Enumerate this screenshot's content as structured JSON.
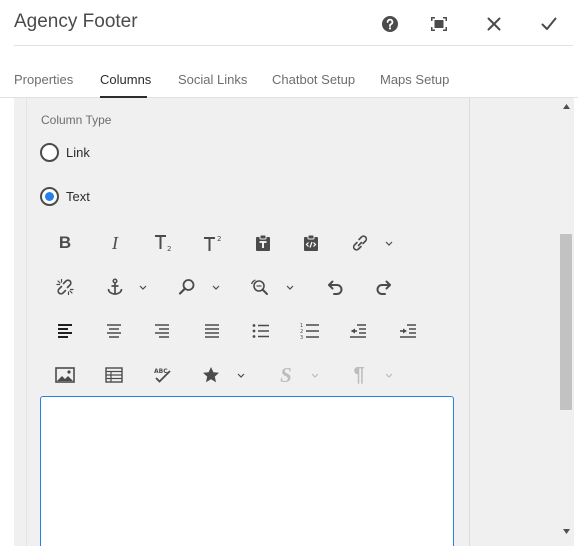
{
  "dialog": {
    "title": "Agency Footer",
    "header_buttons": [
      {
        "name": "help-icon"
      },
      {
        "name": "fullscreen-icon"
      },
      {
        "name": "close-icon"
      },
      {
        "name": "checkmark-icon"
      }
    ]
  },
  "tabs": [
    {
      "label": "Properties",
      "active": false
    },
    {
      "label": "Columns",
      "active": true
    },
    {
      "label": "Social Links",
      "active": false
    },
    {
      "label": "Chatbot Setup",
      "active": false
    },
    {
      "label": "Maps Setup",
      "active": false
    }
  ],
  "form": {
    "column_type_label": "Column Type",
    "options": [
      {
        "label": "Link",
        "checked": false
      },
      {
        "label": "Text",
        "checked": true
      }
    ]
  },
  "toolbar": {
    "rows": [
      [
        "bold-icon",
        "italic-icon",
        "subscript-icon",
        "superscript-icon",
        "paste-text-icon",
        "paste-code-icon",
        "link-icon"
      ],
      [
        "unlink-icon",
        "anchor-icon",
        "find-icon",
        "find-replace-icon",
        "undo-icon",
        "redo-icon"
      ],
      [
        "align-left-icon",
        "align-center-icon",
        "align-right-icon",
        "justify-icon",
        "bullet-list-icon",
        "numbered-list-icon",
        "outdent-icon",
        "indent-icon"
      ],
      [
        "image-icon",
        "table-icon",
        "spellcheck-icon",
        "special-chars-icon",
        "styles-icon",
        "paragraph-format-icon"
      ]
    ],
    "labels": {
      "bold": "B",
      "italic": "I",
      "styles": "S",
      "paragraph": "¶",
      "abc": "ABC"
    }
  },
  "colors": {
    "accent": "#2680eb",
    "panel": "#f0f0f0",
    "text": "#2c2c2c",
    "muted": "#6e6e6e"
  }
}
